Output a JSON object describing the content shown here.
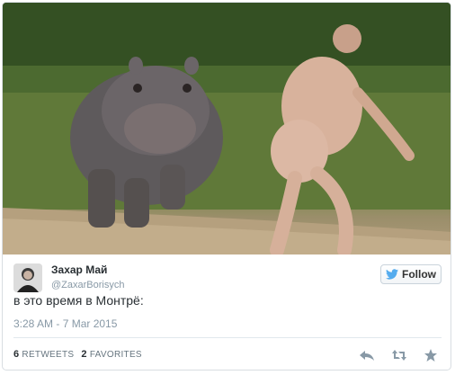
{
  "tweet": {
    "display_name": "Захар Май",
    "handle": "@ZaxarBorisych",
    "text": "в это время в Монтрё:",
    "timestamp": "3:28 AM - 7 Mar 2015",
    "follow_label": "Follow",
    "retweets_count": "6",
    "retweets_label": "RETWEETS",
    "favorites_count": "2",
    "favorites_label": "FAVORITES"
  },
  "icons": {
    "follow": "twitter-bird-icon",
    "reply": "reply-icon",
    "retweet": "retweet-icon",
    "favorite": "star-icon"
  },
  "colors": {
    "accent": "#55acee",
    "text": "#292f33",
    "muted": "#8899a6"
  }
}
